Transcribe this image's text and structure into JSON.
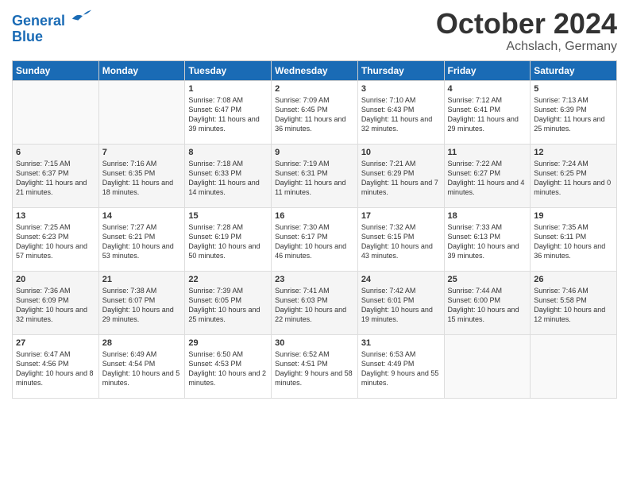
{
  "logo": {
    "line1": "General",
    "line2": "Blue"
  },
  "header": {
    "month": "October 2024",
    "location": "Achslach, Germany"
  },
  "weekdays": [
    "Sunday",
    "Monday",
    "Tuesday",
    "Wednesday",
    "Thursday",
    "Friday",
    "Saturday"
  ],
  "weeks": [
    [
      {
        "day": "",
        "info": ""
      },
      {
        "day": "",
        "info": ""
      },
      {
        "day": "1",
        "info": "Sunrise: 7:08 AM\nSunset: 6:47 PM\nDaylight: 11 hours and 39 minutes."
      },
      {
        "day": "2",
        "info": "Sunrise: 7:09 AM\nSunset: 6:45 PM\nDaylight: 11 hours and 36 minutes."
      },
      {
        "day": "3",
        "info": "Sunrise: 7:10 AM\nSunset: 6:43 PM\nDaylight: 11 hours and 32 minutes."
      },
      {
        "day": "4",
        "info": "Sunrise: 7:12 AM\nSunset: 6:41 PM\nDaylight: 11 hours and 29 minutes."
      },
      {
        "day": "5",
        "info": "Sunrise: 7:13 AM\nSunset: 6:39 PM\nDaylight: 11 hours and 25 minutes."
      }
    ],
    [
      {
        "day": "6",
        "info": "Sunrise: 7:15 AM\nSunset: 6:37 PM\nDaylight: 11 hours and 21 minutes."
      },
      {
        "day": "7",
        "info": "Sunrise: 7:16 AM\nSunset: 6:35 PM\nDaylight: 11 hours and 18 minutes."
      },
      {
        "day": "8",
        "info": "Sunrise: 7:18 AM\nSunset: 6:33 PM\nDaylight: 11 hours and 14 minutes."
      },
      {
        "day": "9",
        "info": "Sunrise: 7:19 AM\nSunset: 6:31 PM\nDaylight: 11 hours and 11 minutes."
      },
      {
        "day": "10",
        "info": "Sunrise: 7:21 AM\nSunset: 6:29 PM\nDaylight: 11 hours and 7 minutes."
      },
      {
        "day": "11",
        "info": "Sunrise: 7:22 AM\nSunset: 6:27 PM\nDaylight: 11 hours and 4 minutes."
      },
      {
        "day": "12",
        "info": "Sunrise: 7:24 AM\nSunset: 6:25 PM\nDaylight: 11 hours and 0 minutes."
      }
    ],
    [
      {
        "day": "13",
        "info": "Sunrise: 7:25 AM\nSunset: 6:23 PM\nDaylight: 10 hours and 57 minutes."
      },
      {
        "day": "14",
        "info": "Sunrise: 7:27 AM\nSunset: 6:21 PM\nDaylight: 10 hours and 53 minutes."
      },
      {
        "day": "15",
        "info": "Sunrise: 7:28 AM\nSunset: 6:19 PM\nDaylight: 10 hours and 50 minutes."
      },
      {
        "day": "16",
        "info": "Sunrise: 7:30 AM\nSunset: 6:17 PM\nDaylight: 10 hours and 46 minutes."
      },
      {
        "day": "17",
        "info": "Sunrise: 7:32 AM\nSunset: 6:15 PM\nDaylight: 10 hours and 43 minutes."
      },
      {
        "day": "18",
        "info": "Sunrise: 7:33 AM\nSunset: 6:13 PM\nDaylight: 10 hours and 39 minutes."
      },
      {
        "day": "19",
        "info": "Sunrise: 7:35 AM\nSunset: 6:11 PM\nDaylight: 10 hours and 36 minutes."
      }
    ],
    [
      {
        "day": "20",
        "info": "Sunrise: 7:36 AM\nSunset: 6:09 PM\nDaylight: 10 hours and 32 minutes."
      },
      {
        "day": "21",
        "info": "Sunrise: 7:38 AM\nSunset: 6:07 PM\nDaylight: 10 hours and 29 minutes."
      },
      {
        "day": "22",
        "info": "Sunrise: 7:39 AM\nSunset: 6:05 PM\nDaylight: 10 hours and 25 minutes."
      },
      {
        "day": "23",
        "info": "Sunrise: 7:41 AM\nSunset: 6:03 PM\nDaylight: 10 hours and 22 minutes."
      },
      {
        "day": "24",
        "info": "Sunrise: 7:42 AM\nSunset: 6:01 PM\nDaylight: 10 hours and 19 minutes."
      },
      {
        "day": "25",
        "info": "Sunrise: 7:44 AM\nSunset: 6:00 PM\nDaylight: 10 hours and 15 minutes."
      },
      {
        "day": "26",
        "info": "Sunrise: 7:46 AM\nSunset: 5:58 PM\nDaylight: 10 hours and 12 minutes."
      }
    ],
    [
      {
        "day": "27",
        "info": "Sunrise: 6:47 AM\nSunset: 4:56 PM\nDaylight: 10 hours and 8 minutes."
      },
      {
        "day": "28",
        "info": "Sunrise: 6:49 AM\nSunset: 4:54 PM\nDaylight: 10 hours and 5 minutes."
      },
      {
        "day": "29",
        "info": "Sunrise: 6:50 AM\nSunset: 4:53 PM\nDaylight: 10 hours and 2 minutes."
      },
      {
        "day": "30",
        "info": "Sunrise: 6:52 AM\nSunset: 4:51 PM\nDaylight: 9 hours and 58 minutes."
      },
      {
        "day": "31",
        "info": "Sunrise: 6:53 AM\nSunset: 4:49 PM\nDaylight: 9 hours and 55 minutes."
      },
      {
        "day": "",
        "info": ""
      },
      {
        "day": "",
        "info": ""
      }
    ]
  ]
}
